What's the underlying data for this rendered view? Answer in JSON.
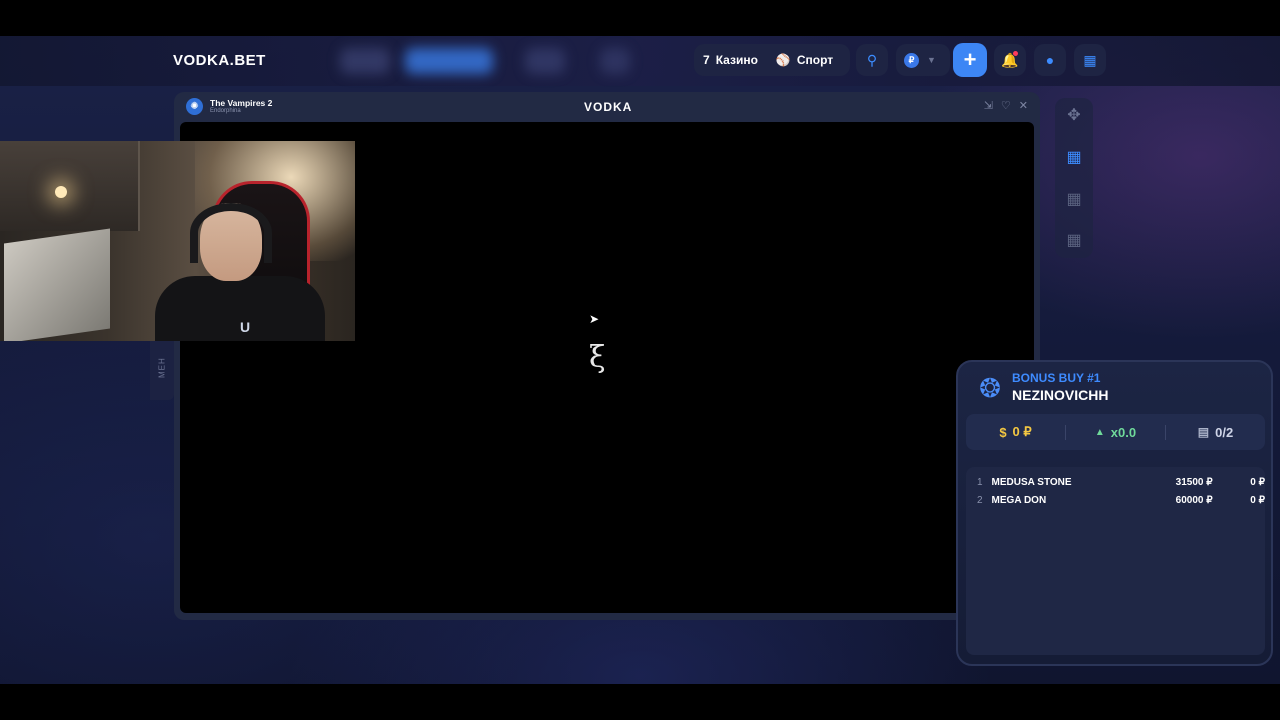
{
  "navbar": {
    "logo": "VODKA.BET",
    "casino_label": "Казино",
    "sport_label": "Спорт",
    "coin_symbol": "₽",
    "plus_label": "+"
  },
  "game": {
    "title": "The Vampires 2",
    "provider": "Endorphina",
    "window_logo": "VODKA"
  },
  "side_tab": {
    "label": "МЕН"
  },
  "bonus_buy": {
    "label": "BONUS BUY #1",
    "name": "NEZINOVICHH",
    "stats": {
      "money": "0 ₽",
      "multiplier": "x0.0",
      "count": "0/2"
    },
    "rows": [
      {
        "num": "1",
        "game": "MEDUSA STONE",
        "price": "31500 ₽",
        "win": "0 ₽"
      },
      {
        "num": "2",
        "game": "MEGA DON",
        "price": "60000 ₽",
        "win": "0 ₽"
      }
    ]
  },
  "colors": {
    "accent": "#3d86f5",
    "money": "#f4c842",
    "multiplier": "#6fd99a",
    "panel": "#1c2544"
  }
}
